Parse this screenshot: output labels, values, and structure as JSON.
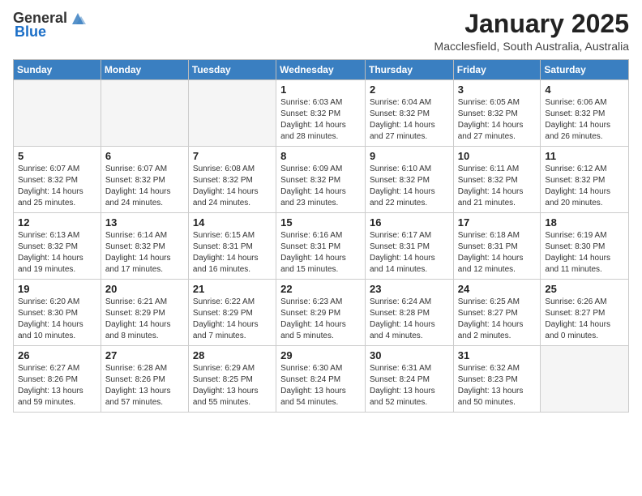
{
  "header": {
    "logo_general": "General",
    "logo_blue": "Blue",
    "month_title": "January 2025",
    "location": "Macclesfield, South Australia, Australia"
  },
  "days_of_week": [
    "Sunday",
    "Monday",
    "Tuesday",
    "Wednesday",
    "Thursday",
    "Friday",
    "Saturday"
  ],
  "weeks": [
    [
      {
        "day": "",
        "info": ""
      },
      {
        "day": "",
        "info": ""
      },
      {
        "day": "",
        "info": ""
      },
      {
        "day": "1",
        "info": "Sunrise: 6:03 AM\nSunset: 8:32 PM\nDaylight: 14 hours\nand 28 minutes."
      },
      {
        "day": "2",
        "info": "Sunrise: 6:04 AM\nSunset: 8:32 PM\nDaylight: 14 hours\nand 27 minutes."
      },
      {
        "day": "3",
        "info": "Sunrise: 6:05 AM\nSunset: 8:32 PM\nDaylight: 14 hours\nand 27 minutes."
      },
      {
        "day": "4",
        "info": "Sunrise: 6:06 AM\nSunset: 8:32 PM\nDaylight: 14 hours\nand 26 minutes."
      }
    ],
    [
      {
        "day": "5",
        "info": "Sunrise: 6:07 AM\nSunset: 8:32 PM\nDaylight: 14 hours\nand 25 minutes."
      },
      {
        "day": "6",
        "info": "Sunrise: 6:07 AM\nSunset: 8:32 PM\nDaylight: 14 hours\nand 24 minutes."
      },
      {
        "day": "7",
        "info": "Sunrise: 6:08 AM\nSunset: 8:32 PM\nDaylight: 14 hours\nand 24 minutes."
      },
      {
        "day": "8",
        "info": "Sunrise: 6:09 AM\nSunset: 8:32 PM\nDaylight: 14 hours\nand 23 minutes."
      },
      {
        "day": "9",
        "info": "Sunrise: 6:10 AM\nSunset: 8:32 PM\nDaylight: 14 hours\nand 22 minutes."
      },
      {
        "day": "10",
        "info": "Sunrise: 6:11 AM\nSunset: 8:32 PM\nDaylight: 14 hours\nand 21 minutes."
      },
      {
        "day": "11",
        "info": "Sunrise: 6:12 AM\nSunset: 8:32 PM\nDaylight: 14 hours\nand 20 minutes."
      }
    ],
    [
      {
        "day": "12",
        "info": "Sunrise: 6:13 AM\nSunset: 8:32 PM\nDaylight: 14 hours\nand 19 minutes."
      },
      {
        "day": "13",
        "info": "Sunrise: 6:14 AM\nSunset: 8:32 PM\nDaylight: 14 hours\nand 17 minutes."
      },
      {
        "day": "14",
        "info": "Sunrise: 6:15 AM\nSunset: 8:31 PM\nDaylight: 14 hours\nand 16 minutes."
      },
      {
        "day": "15",
        "info": "Sunrise: 6:16 AM\nSunset: 8:31 PM\nDaylight: 14 hours\nand 15 minutes."
      },
      {
        "day": "16",
        "info": "Sunrise: 6:17 AM\nSunset: 8:31 PM\nDaylight: 14 hours\nand 14 minutes."
      },
      {
        "day": "17",
        "info": "Sunrise: 6:18 AM\nSunset: 8:31 PM\nDaylight: 14 hours\nand 12 minutes."
      },
      {
        "day": "18",
        "info": "Sunrise: 6:19 AM\nSunset: 8:30 PM\nDaylight: 14 hours\nand 11 minutes."
      }
    ],
    [
      {
        "day": "19",
        "info": "Sunrise: 6:20 AM\nSunset: 8:30 PM\nDaylight: 14 hours\nand 10 minutes."
      },
      {
        "day": "20",
        "info": "Sunrise: 6:21 AM\nSunset: 8:29 PM\nDaylight: 14 hours\nand 8 minutes."
      },
      {
        "day": "21",
        "info": "Sunrise: 6:22 AM\nSunset: 8:29 PM\nDaylight: 14 hours\nand 7 minutes."
      },
      {
        "day": "22",
        "info": "Sunrise: 6:23 AM\nSunset: 8:29 PM\nDaylight: 14 hours\nand 5 minutes."
      },
      {
        "day": "23",
        "info": "Sunrise: 6:24 AM\nSunset: 8:28 PM\nDaylight: 14 hours\nand 4 minutes."
      },
      {
        "day": "24",
        "info": "Sunrise: 6:25 AM\nSunset: 8:27 PM\nDaylight: 14 hours\nand 2 minutes."
      },
      {
        "day": "25",
        "info": "Sunrise: 6:26 AM\nSunset: 8:27 PM\nDaylight: 14 hours\nand 0 minutes."
      }
    ],
    [
      {
        "day": "26",
        "info": "Sunrise: 6:27 AM\nSunset: 8:26 PM\nDaylight: 13 hours\nand 59 minutes."
      },
      {
        "day": "27",
        "info": "Sunrise: 6:28 AM\nSunset: 8:26 PM\nDaylight: 13 hours\nand 57 minutes."
      },
      {
        "day": "28",
        "info": "Sunrise: 6:29 AM\nSunset: 8:25 PM\nDaylight: 13 hours\nand 55 minutes."
      },
      {
        "day": "29",
        "info": "Sunrise: 6:30 AM\nSunset: 8:24 PM\nDaylight: 13 hours\nand 54 minutes."
      },
      {
        "day": "30",
        "info": "Sunrise: 6:31 AM\nSunset: 8:24 PM\nDaylight: 13 hours\nand 52 minutes."
      },
      {
        "day": "31",
        "info": "Sunrise: 6:32 AM\nSunset: 8:23 PM\nDaylight: 13 hours\nand 50 minutes."
      },
      {
        "day": "",
        "info": ""
      }
    ]
  ]
}
